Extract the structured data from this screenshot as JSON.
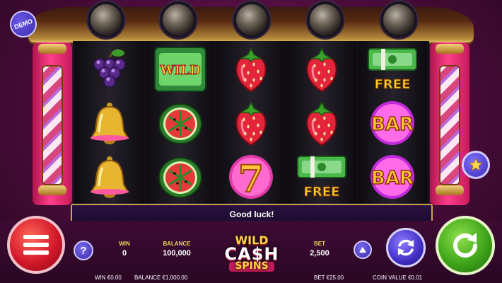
{
  "badge": {
    "demo_label": "DEMO"
  },
  "message": {
    "text": "Good luck!"
  },
  "stats": {
    "win_label": "WIN",
    "win_value": "0",
    "balance_label": "BALANCE",
    "balance_value": "100,000",
    "bet_label": "BET",
    "bet_value": "2,500"
  },
  "footer": {
    "win": "WIN €0.00",
    "balance": "BALANCE €1,000.00",
    "bet": "BET €25.00",
    "coin_value": "COIN VALUE €0.01"
  },
  "logo": {
    "line1": "WILD",
    "line2": "CA$H",
    "line3": "SPINS"
  },
  "buttons": {
    "help_label": "?"
  },
  "reels": [
    [
      "grapes-icon",
      "bell-icon",
      "bell-icon"
    ],
    [
      "wild-icon",
      "watermelon-icon",
      "watermelon-icon"
    ],
    [
      "strawberry-icon",
      "strawberry-icon",
      "seven-icon"
    ],
    [
      "strawberry-icon",
      "strawberry-icon",
      "free-cash-icon"
    ],
    [
      "free-cash-icon",
      "bar-icon",
      "bar-icon"
    ]
  ],
  "symbol_text": {
    "wild": "WILD",
    "free": "FREE",
    "bar": "BAR",
    "seven": "7"
  }
}
